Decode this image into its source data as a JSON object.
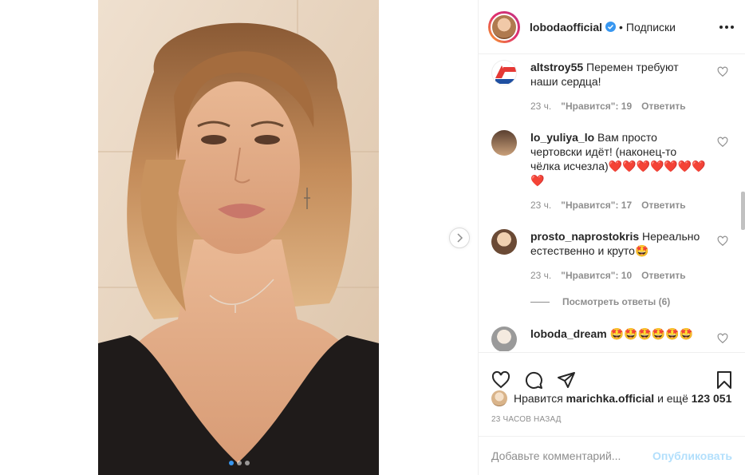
{
  "post": {
    "username": "lobodaofficial",
    "separator": "•",
    "follow_label": "Подписки",
    "more_icon": "more-dots-icon",
    "carousel_pages": 3,
    "carousel_active": 0
  },
  "comments": [
    {
      "username": "altstroy55",
      "text": "Перемен требуют наши сердца!",
      "time": "23 ч.",
      "likes": "\"Нравится\": 19",
      "reply": "Ответить"
    },
    {
      "username": "lo_yuliya_lo",
      "text": "Вам просто чертовски идёт! (наконец-то чёлка исчезла)❤️❤️❤️❤️❤️❤️❤️❤️",
      "time": "23 ч.",
      "likes": "\"Нравится\": 17",
      "reply": "Ответить"
    },
    {
      "username": "prosto_naprostokris",
      "text": "Нереально естественно и круто🤩",
      "time": "23 ч.",
      "likes": "\"Нравится\": 10",
      "reply": "Ответить"
    },
    {
      "username": "loboda_dream",
      "text": "🤩🤩🤩🤩🤩🤩"
    }
  ],
  "view_replies": "Посмотреть ответы (6)",
  "likes": {
    "prefix": "Нравится",
    "user": "marichka.official",
    "middle": "и ещё",
    "count": "123 051"
  },
  "timestamp": "23 ЧАСОВ НАЗАД",
  "add_comment": {
    "placeholder": "Добавьте комментарий...",
    "publish_label": "Опубликовать"
  },
  "colors": {
    "verified": "#3897f0",
    "publish_disabled": "#b2dffc",
    "heart": "#ed1c24"
  }
}
